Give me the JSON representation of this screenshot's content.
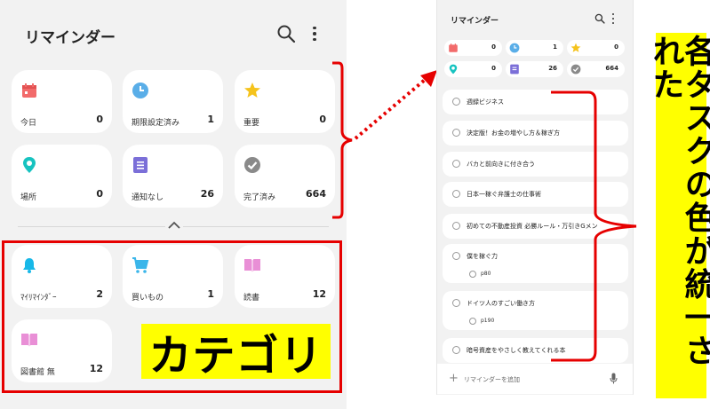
{
  "left": {
    "title": "リマインダー",
    "cards": [
      {
        "icon": "calendar-icon",
        "label": "今日",
        "count": "0",
        "color": "#f26b6b"
      },
      {
        "icon": "clock-icon",
        "label": "期限設定済み",
        "count": "1",
        "color": "#5aaee8"
      },
      {
        "icon": "star-icon",
        "label": "重要",
        "count": "0",
        "color": "#f5c31c"
      },
      {
        "icon": "location-pin-icon",
        "label": "場所",
        "count": "0",
        "color": "#17c3c0"
      },
      {
        "icon": "note-icon",
        "label": "通知なし",
        "count": "26",
        "color": "#7b6fd8"
      },
      {
        "icon": "check-circle-icon",
        "label": "完了済み",
        "count": "664",
        "color": "#8a8a8a"
      }
    ],
    "categories": [
      {
        "icon": "bell-icon",
        "label": "ﾏｲﾘﾏｲﾝﾀﾞｰ",
        "count": "2",
        "color": "#17b8e8"
      },
      {
        "icon": "cart-icon",
        "label": "買いもの",
        "count": "1",
        "color": "#3bb6ea"
      },
      {
        "icon": "book-icon",
        "label": "読書",
        "count": "12",
        "color": "#e98fd6"
      },
      {
        "icon": "book-icon",
        "label": "図書館 無",
        "count": "12",
        "color": "#e98fd6"
      }
    ],
    "category_banner": "カテゴリ"
  },
  "right": {
    "title": "リマインダー",
    "chips": [
      {
        "icon": "calendar-icon",
        "count": "0",
        "color": "#f26b6b"
      },
      {
        "icon": "clock-icon",
        "count": "1",
        "color": "#5aaee8"
      },
      {
        "icon": "star-icon",
        "count": "0",
        "color": "#f5c31c"
      },
      {
        "icon": "location-pin-icon",
        "count": "0",
        "color": "#17c3c0"
      },
      {
        "icon": "note-icon",
        "count": "26",
        "color": "#7b6fd8"
      },
      {
        "icon": "check-circle-icon",
        "count": "664",
        "color": "#8a8a8a"
      }
    ],
    "tasks": [
      {
        "text": "週録ビジネス"
      },
      {
        "text": "決定版！お金の増やし方＆稼ぎ方"
      },
      {
        "text": "バカと前向きに付き合う"
      },
      {
        "text": "日本一稼ぐ弁護士の仕事術"
      },
      {
        "text": "初めての不動産投資 必勝ルール・万引きGメン"
      },
      {
        "text": "僕を稼ぐ力",
        "sub": "p80"
      },
      {
        "text": "ドイツ人のすごい働き方",
        "sub": "p190"
      },
      {
        "text": "暗号資産をやさしく教えてくれる本"
      }
    ],
    "add_placeholder": "リマインダーを追加"
  },
  "vertical_banner": "各タスクの色が統一された"
}
